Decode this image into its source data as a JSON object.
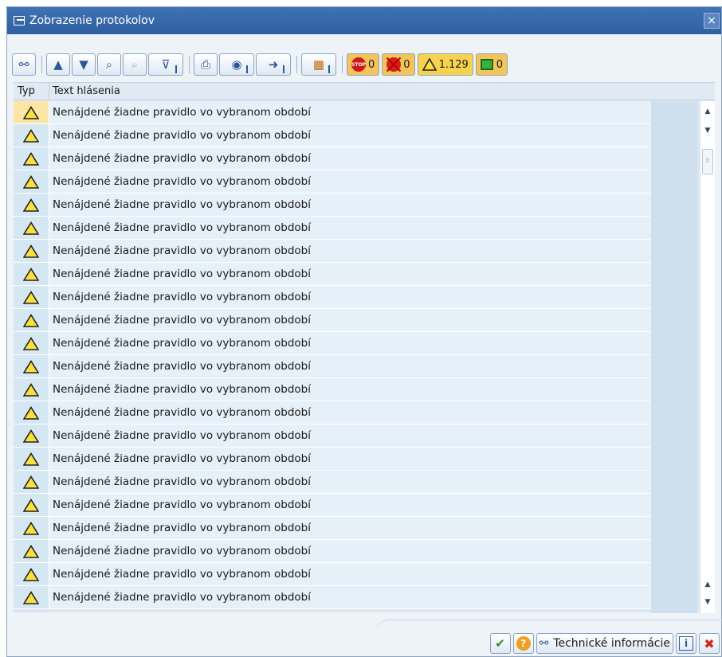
{
  "window": {
    "title": "Zobrazenie protokolov",
    "close_label": "×"
  },
  "toolbar": {
    "counts": {
      "stop": "0",
      "error": "0",
      "warning": "1.129",
      "ok": "0"
    },
    "stop_icon_text": "STOP"
  },
  "grid": {
    "columns": {
      "type": "Typ",
      "text": "Text hlásenia"
    },
    "rows": [
      "Nenájdené žiadne pravidlo vo vybranom období",
      "Nenájdené žiadne pravidlo vo vybranom období",
      "Nenájdené žiadne pravidlo vo vybranom období",
      "Nenájdené žiadne pravidlo vo vybranom období",
      "Nenájdené žiadne pravidlo vo vybranom období",
      "Nenájdené žiadne pravidlo vo vybranom období",
      "Nenájdené žiadne pravidlo vo vybranom období",
      "Nenájdené žiadne pravidlo vo vybranom období",
      "Nenájdené žiadne pravidlo vo vybranom období",
      "Nenájdené žiadne pravidlo vo vybranom období",
      "Nenájdené žiadne pravidlo vo vybranom období",
      "Nenájdené žiadne pravidlo vo vybranom období",
      "Nenájdené žiadne pravidlo vo vybranom období",
      "Nenájdené žiadne pravidlo vo vybranom období",
      "Nenájdené žiadne pravidlo vo vybranom období",
      "Nenájdené žiadne pravidlo vo vybranom období",
      "Nenájdené žiadne pravidlo vo vybranom období",
      "Nenájdené žiadne pravidlo vo vybranom období",
      "Nenájdené žiadne pravidlo vo vybranom období",
      "Nenájdené žiadne pravidlo vo vybranom období",
      "Nenájdené žiadne pravidlo vo vybranom období",
      "Nenájdené žiadne pravidlo vo vybranom období"
    ]
  },
  "footer": {
    "tech_info_label": "Technické informácie"
  }
}
